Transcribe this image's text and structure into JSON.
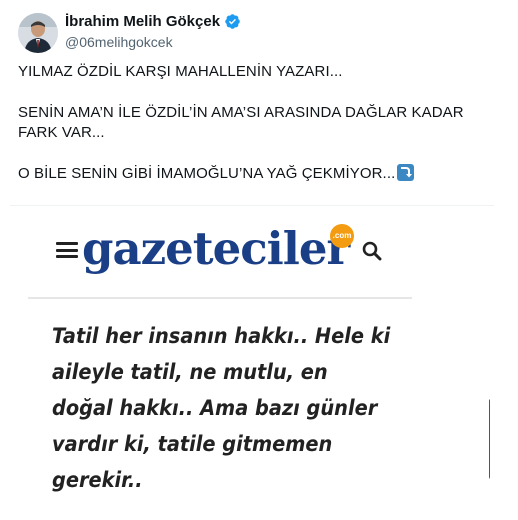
{
  "author": {
    "name": "İbrahim Melih Gökçek",
    "handle": "@06melihgokcek",
    "verified_icon": "verified-badge-icon",
    "avatar_icon": "avatar"
  },
  "tweet": {
    "line1": "YILMAZ ÖZDİL KARŞI MAHALLENİN YAZARI...",
    "line2": "SENİN AMA’N İLE ÖZDİL’İN AMA’SI ARASINDA DAĞLAR KADAR FARK VAR...",
    "line3": "O BİLE SENİN GİBİ İMAMOĞLU’NA YAĞ ÇEKMİYOR...",
    "emoji": "right-arrow-curving-down-icon"
  },
  "media": {
    "logo_text": "gazeteciler",
    "logo_badge": ".com",
    "quote": "Tatil her insanın hakkı.. Hele ki aileyle tatil, ne mutlu, en doğal hakkı.. Ama bazı günler vardır ki, tatile gitmemen gerekir.."
  },
  "colors": {
    "text": "#0f1419",
    "muted": "#536471",
    "verified": "#1d9bf0",
    "logo": "#1a3f86",
    "badge": "#f39c12"
  }
}
